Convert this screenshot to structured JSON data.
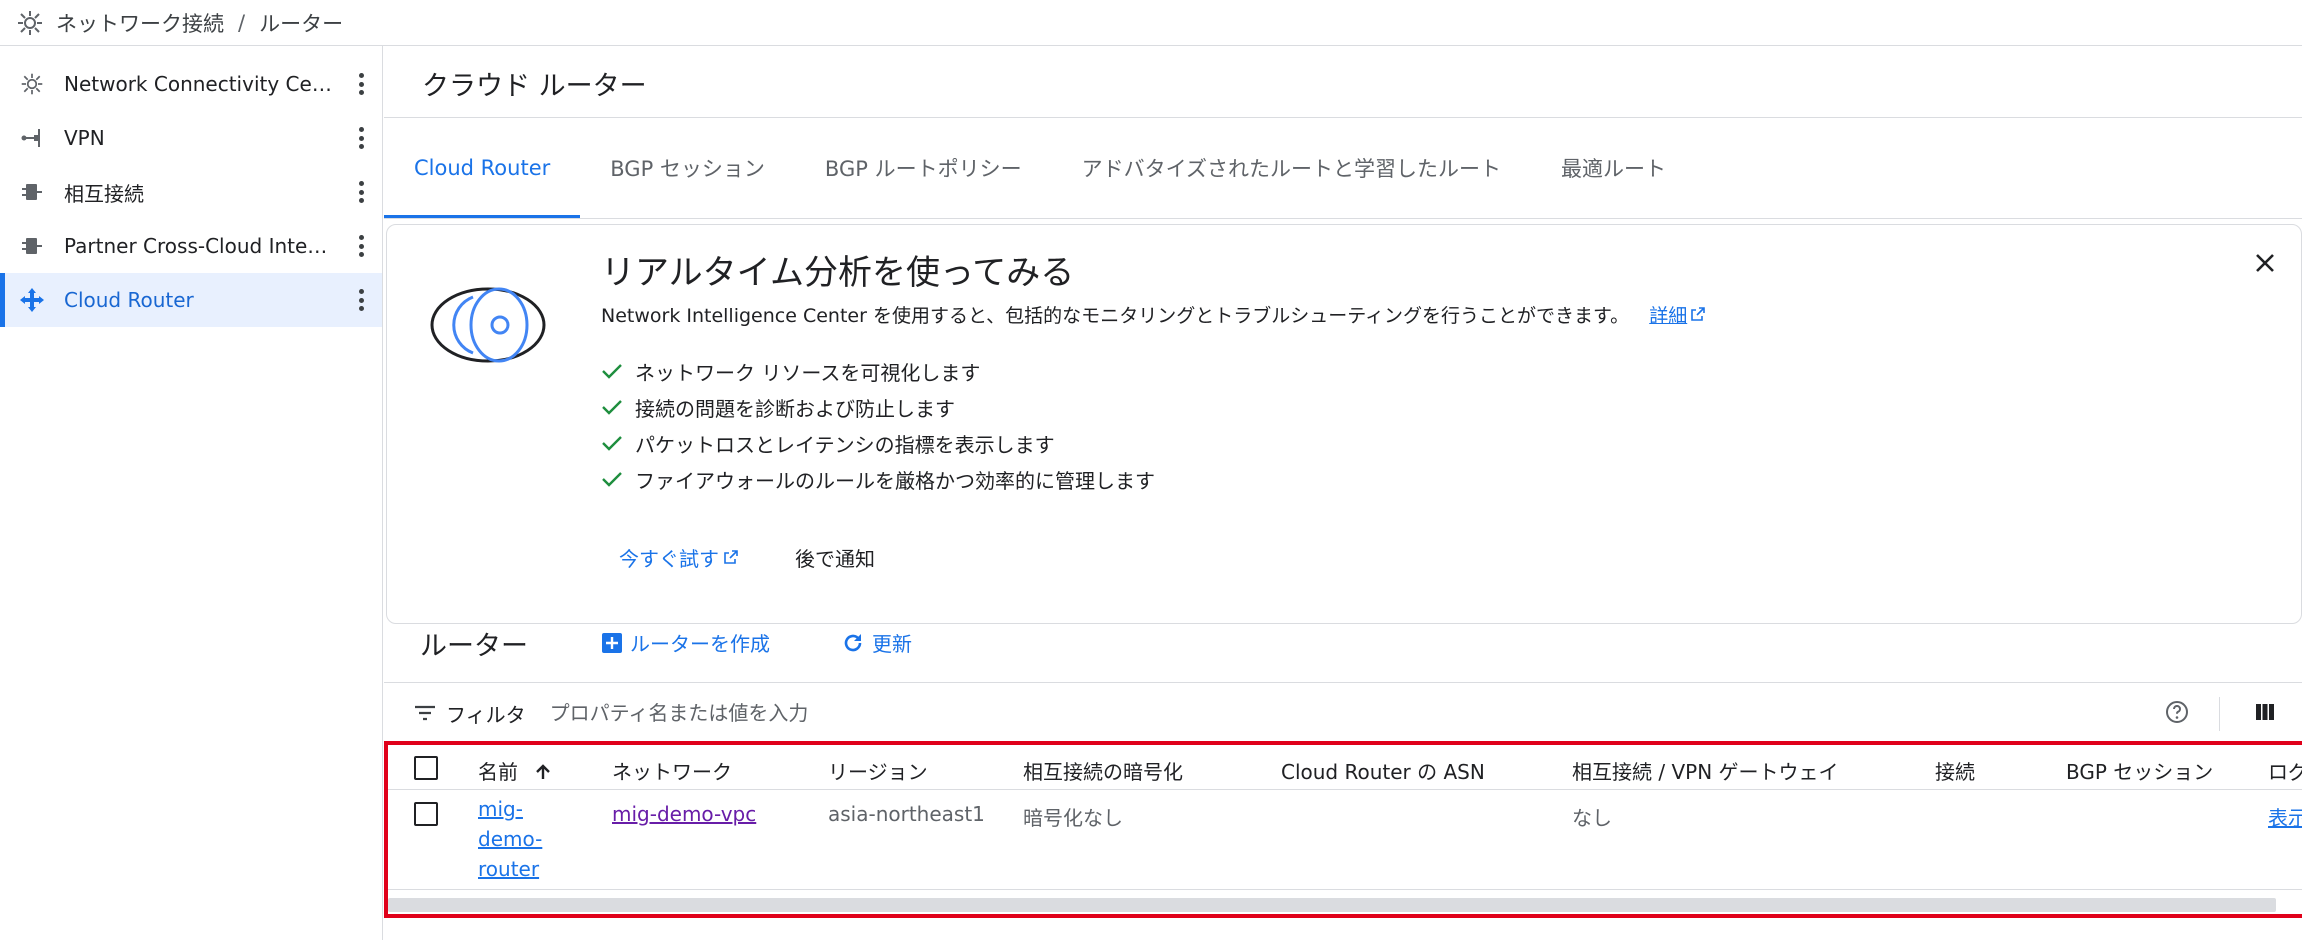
{
  "breadcrumb": {
    "section": "ネットワーク接続",
    "separator": "/",
    "page": "ルーター"
  },
  "sidebar": {
    "items": [
      {
        "label": "Network Connectivity Center",
        "icon": "hub-icon",
        "active": false
      },
      {
        "label": "VPN",
        "icon": "vpn-icon",
        "active": false
      },
      {
        "label": "相互接続",
        "icon": "interconnect-icon",
        "active": false
      },
      {
        "label": "Partner Cross-Cloud Interconnect",
        "icon": "cross-cloud-icon",
        "active": false
      },
      {
        "label": "Cloud Router",
        "icon": "cloud-router-icon",
        "active": true
      }
    ]
  },
  "main": {
    "title": "クラウド ルーター",
    "tabs": [
      {
        "label": "Cloud Router",
        "active": true
      },
      {
        "label": "BGP セッション",
        "active": false
      },
      {
        "label": "BGP ルートポリシー",
        "active": false
      },
      {
        "label": "アドバタイズされたルートと学習したルート",
        "active": false
      },
      {
        "label": "最適ルート",
        "active": false
      }
    ]
  },
  "promo": {
    "title": "リアルタイム分析を使ってみる",
    "description": "Network Intelligence Center を使用すると、包括的なモニタリングとトラブルシューティングを行うことができます。",
    "details_link": "詳細",
    "bullets": [
      "ネットワーク リソースを可視化します",
      "接続の問題を診断および防止します",
      "パケットロスとレイテンシの指標を表示します",
      "ファイアウォールのルールを厳格かつ効率的に管理します"
    ],
    "try_now": "今すぐ試す",
    "remind_later": "後で通知"
  },
  "routers": {
    "title": "ルーター",
    "create_label": "ルーターを作成",
    "refresh_label": "更新",
    "filter_label": "フィルタ",
    "filter_placeholder": "プロパティ名または値を入力",
    "columns": [
      "名前",
      "ネットワーク",
      "リージョン",
      "相互接続の暗号化",
      "Cloud Router の ASN",
      "相互接続 / VPN ゲートウェイ",
      "接続",
      "BGP セッション",
      "ログ"
    ],
    "sort": {
      "column": "名前",
      "direction": "ascending"
    },
    "rows": [
      {
        "name": "mig-demo-router",
        "network": "mig-demo-vpc",
        "region": "asia-northeast1",
        "encryption": "暗号化なし",
        "asn": "",
        "gateway": "なし",
        "connection": "",
        "bgp": "",
        "log": "表示"
      }
    ]
  },
  "colors": {
    "accent": "#1a73e8",
    "highlight": "#e0001a",
    "active_bg": "#e8f0fe",
    "visited_link": "#681da8"
  }
}
